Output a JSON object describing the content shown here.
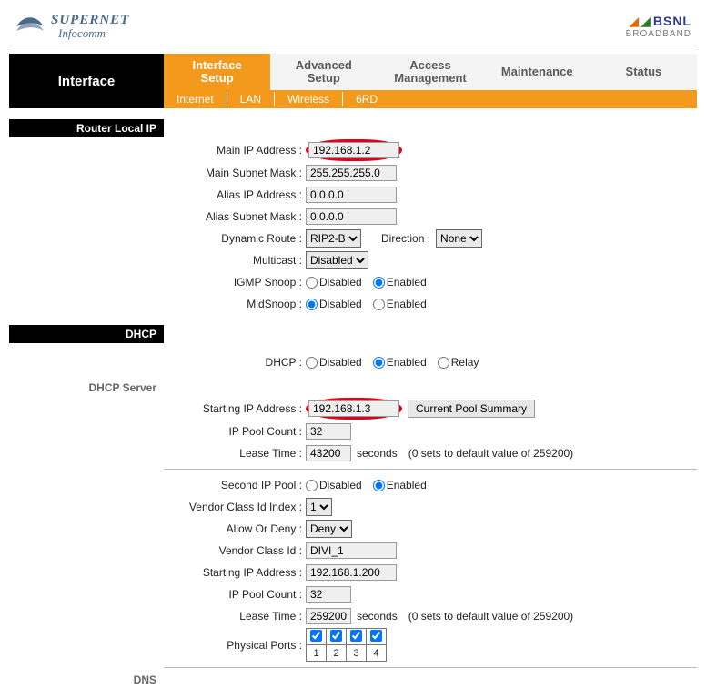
{
  "brand_left": {
    "line1": "SUPERNET",
    "line2": "Infocomm"
  },
  "brand_right": {
    "line1": "BSNL",
    "line2": "BROADBAND"
  },
  "nav": {
    "title": "Interface",
    "tabs": {
      "interface_setup": "Interface\nSetup",
      "advanced_setup": "Advanced\nSetup",
      "access_mgmt": "Access\nManagement",
      "maintenance": "Maintenance",
      "status": "Status"
    },
    "subtabs": {
      "internet": "Internet",
      "lan": "LAN",
      "wireless": "Wireless",
      "_6rd": "6RD"
    }
  },
  "sections": {
    "router_local_ip": "Router Local IP",
    "dhcp": "DHCP",
    "dhcp_server": "DHCP Server",
    "dns": "DNS"
  },
  "labels": {
    "main_ip": "Main IP Address :",
    "main_subnet": "Main Subnet Mask :",
    "alias_ip": "Alias IP Address :",
    "alias_subnet": "Alias Subnet Mask :",
    "dyn_route": "Dynamic Route :",
    "direction": "Direction :",
    "multicast": "Multicast :",
    "igmp_snoop": "IGMP Snoop :",
    "mld_snoop": "MldSnoop :",
    "dhcp_mode": "DHCP :",
    "start_ip": "Starting IP Address :",
    "ip_pool_count": "IP Pool Count :",
    "lease_time": "Lease Time :",
    "seconds": "seconds",
    "lease_note": "(0 sets to default value of 259200)",
    "second_ip_pool": "Second IP Pool :",
    "vendor_idx": "Vendor Class Id Index :",
    "allow_deny": "Allow Or Deny :",
    "vendor_class_id": "Vendor Class Id :",
    "start_ip2": "Starting IP Address :",
    "ip_pool_count2": "IP Pool Count :",
    "lease_time2": "Lease Time :",
    "phys_ports": "Physical Ports :"
  },
  "radio": {
    "disabled": "Disabled",
    "enabled": "Enabled",
    "relay": "Relay"
  },
  "buttons": {
    "current_pool_summary": "Current Pool Summary"
  },
  "values": {
    "main_ip": "192.168.1.2",
    "main_subnet": "255.255.255.0",
    "alias_ip": "0.0.0.0",
    "alias_subnet": "0.0.0.0",
    "dyn_route": "RIP2-B",
    "direction": "None",
    "multicast": "Disabled",
    "igmp_snoop": "enabled",
    "mld_snoop": "disabled",
    "dhcp_mode": "enabled",
    "start_ip": "192.168.1.3",
    "ip_pool_count": "32",
    "lease_time": "43200",
    "second_ip_pool": "enabled",
    "vendor_idx": "1",
    "allow_deny": "Deny",
    "vendor_class_id": "DIVI_1",
    "start_ip2": "192.168.1.200",
    "ip_pool_count2": "32",
    "lease_time2": "259200",
    "ports": {
      "p1": "1",
      "p2": "2",
      "p3": "3",
      "p4": "4"
    }
  }
}
